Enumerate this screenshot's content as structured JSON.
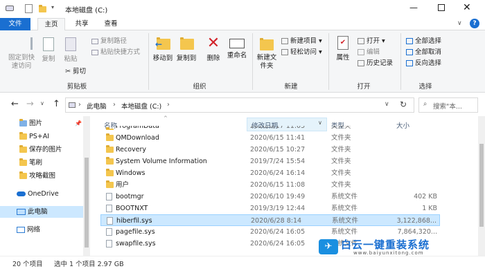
{
  "titlebar": {
    "title": "本地磁盘 (C:)"
  },
  "menu": {
    "file": "文件",
    "home": "主页",
    "share": "共享",
    "view": "查看",
    "help": "?"
  },
  "ribbon": {
    "clipboard": {
      "pin": "固定到快速访问",
      "copy": "复制",
      "paste": "粘贴",
      "copy_path": "复制路径",
      "paste_shortcut": "粘贴快捷方式",
      "cut": "剪切",
      "label": "剪贴板"
    },
    "organize": {
      "move_to": "移动到",
      "copy_to": "复制到",
      "delete": "删除",
      "rename": "重命名",
      "label": "组织"
    },
    "new": {
      "new_folder": "新建文件夹",
      "new_item": "新建项目",
      "easy_access": "轻松访问",
      "label": "新建"
    },
    "open": {
      "properties": "属性",
      "open": "打开",
      "edit": "编辑",
      "history": "历史记录",
      "label": "打开"
    },
    "select": {
      "select_all": "全部选择",
      "select_none": "全部取消",
      "invert": "反向选择",
      "label": "选择"
    }
  },
  "address": {
    "this_pc": "此电脑",
    "drive": "本地磁盘 (C:)",
    "search_placeholder": "搜索\"本..."
  },
  "nav": {
    "quick": [
      {
        "label": "图片"
      },
      {
        "label": "PS+AI"
      },
      {
        "label": "保存的图片"
      },
      {
        "label": "笔刷"
      },
      {
        "label": "攻略截图"
      }
    ],
    "onedrive": "OneDrive",
    "this_pc": "此电脑",
    "network": "网络"
  },
  "columns": {
    "name": "名称",
    "date": "修改日期",
    "type": "类型",
    "size": "大小"
  },
  "files": [
    {
      "name": "ProgramData",
      "date": "2020/6/17 11:05",
      "type": "文件夹",
      "size": "",
      "kind": "folder"
    },
    {
      "name": "QMDownload",
      "date": "2020/6/15 11:41",
      "type": "文件夹",
      "size": "",
      "kind": "folder"
    },
    {
      "name": "Recovery",
      "date": "2020/6/15 10:27",
      "type": "文件夹",
      "size": "",
      "kind": "folder"
    },
    {
      "name": "System Volume Information",
      "date": "2019/7/24 15:54",
      "type": "文件夹",
      "size": "",
      "kind": "folder"
    },
    {
      "name": "Windows",
      "date": "2020/6/24 16:14",
      "type": "文件夹",
      "size": "",
      "kind": "folder"
    },
    {
      "name": "用户",
      "date": "2020/6/15 11:08",
      "type": "文件夹",
      "size": "",
      "kind": "folder"
    },
    {
      "name": "bootmgr",
      "date": "2020/6/10 19:49",
      "type": "系统文件",
      "size": "402 KB",
      "kind": "file"
    },
    {
      "name": "BOOTNXT",
      "date": "2019/3/19 12:44",
      "type": "系统文件",
      "size": "1 KB",
      "kind": "file"
    },
    {
      "name": "hiberfil.sys",
      "date": "2020/6/28 8:14",
      "type": "系统文件",
      "size": "3,122,868...",
      "kind": "file"
    },
    {
      "name": "pagefile.sys",
      "date": "2020/6/24 16:05",
      "type": "系统文件",
      "size": "7,864,320...",
      "kind": "file"
    },
    {
      "name": "swapfile.sys",
      "date": "2020/6/24 16:05",
      "type": "系统文件",
      "size": "",
      "kind": "file"
    }
  ],
  "status": {
    "count": "20 个项目",
    "selected": "选中 1 个项目 2.97 GB"
  },
  "watermark": {
    "brand": "白云一键重装系统",
    "url": "www.baiyunxitong.com"
  },
  "colors": {
    "accent": "#1a6fd1",
    "title_purple": "#8a7fd0",
    "selection": "#cce8ff"
  }
}
